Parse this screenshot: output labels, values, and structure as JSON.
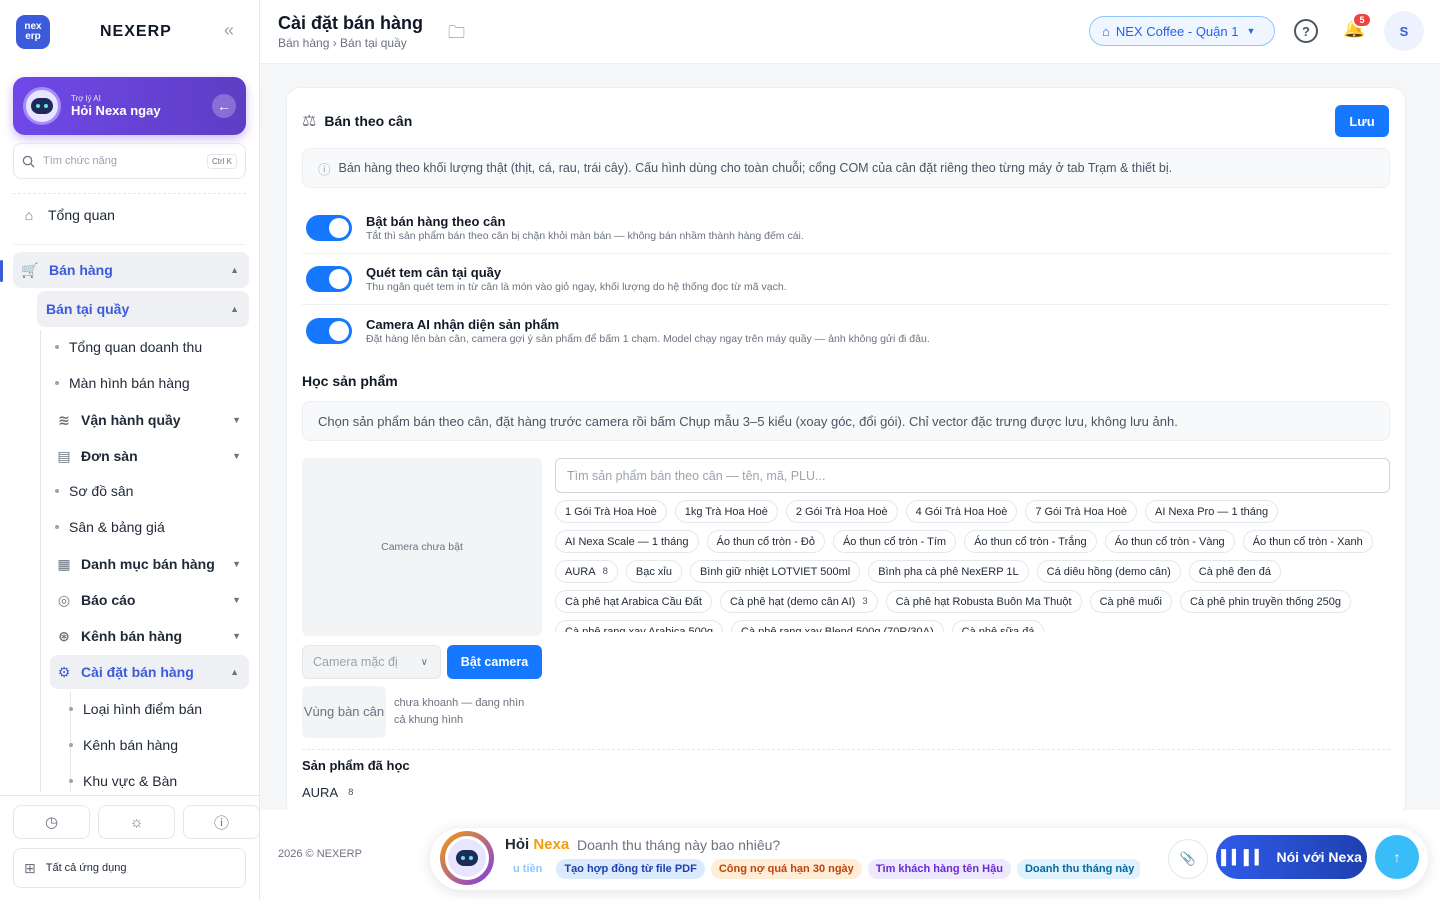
{
  "brand": {
    "logo_text": "nex erp",
    "name": "NEXERP",
    "collapse_icon": "double-chevron-left-icon"
  },
  "ai_card": {
    "small": "Trợ lý AI",
    "title": "Hỏi Nexa ngay"
  },
  "search": {
    "placeholder": "Tìm chức năng",
    "shortcut": "Ctrl K"
  },
  "nav": {
    "overview": "Tổng quan",
    "sales": "Bán hàng",
    "pos": "Bán tại quầy",
    "pos_items": [
      "Tổng quan doanh thu",
      "Màn hình bán hàng",
      "Vận hành quầy",
      "Đơn sàn",
      "Sơ đồ sân",
      "Sân & bảng giá",
      "Danh mục bán hàng",
      "Báo cáo",
      "Kênh bán hàng",
      "Cài đặt bán hàng"
    ],
    "settings_items": [
      "Loại hình điểm bán",
      "Kênh bán hàng",
      "Khu vực & Bàn"
    ]
  },
  "all_apps": "Tất cả ứng dụng",
  "header": {
    "title": "Cài đặt bán hàng",
    "breadcrumb": "Bán hàng › Bán tại quầy",
    "store": "NEX Coffee - Quận 1",
    "notif_count": "5",
    "avatar": "S"
  },
  "card": {
    "title": "Bán theo cân",
    "save": "Lưu",
    "info": "Bán hàng theo khối lượng thật (thịt, cá, rau, trái cây). Cấu hình dùng cho toàn chuỗi; cổng COM của cân đặt riêng theo từng máy ở tab Trạm & thiết bị.",
    "toggles": [
      {
        "title": "Bật bán hàng theo cân",
        "desc": "Tắt thì sản phẩm bán theo cân bị chặn khỏi màn bán — không bán nhầm thành hàng đếm cái.",
        "on": true
      },
      {
        "title": "Quét tem cân tại quầy",
        "desc": "Thu ngân quét tem in từ cân là món vào giỏ ngay, khối lượng do hệ thống đọc từ mã vạch.",
        "on": true
      },
      {
        "title": "Camera AI nhận diện sản phẩm",
        "desc": "Đặt hàng lên bàn cân, camera gợi ý sản phẩm để bấm 1 chạm. Model chạy ngay trên máy quầy — ảnh không gửi đi đâu.",
        "on": true
      }
    ],
    "learn_title": "Học sản phẩm",
    "learn_info": "Chọn sản phẩm bán theo cân, đặt hàng trước camera rồi bấm Chụp mẫu 3–5 kiểu (xoay góc, đổi gói). Chỉ vector đặc trưng được lưu, không lưu ảnh.",
    "camera_off": "Camera chưa bật",
    "camera_select": "Camera mặc đị",
    "camera_button": "Bật camera",
    "zone_label": "Vùng bàn cân",
    "zone_text": "chưa khoanh — đang nhìn cả khung hình",
    "product_search": "Tìm sản phẩm bán theo cân — tên, mã, PLU...",
    "products": [
      {
        "name": "1 Gói Trà Hoa Hoè"
      },
      {
        "name": "1kg Trà Hoa Hoè"
      },
      {
        "name": "2 Gói Trà Hoa Hoè"
      },
      {
        "name": "4 Gói Trà Hoa Hoè"
      },
      {
        "name": "7 Gói Trà Hoa Hoè"
      },
      {
        "name": "AI Nexa Pro — 1 tháng"
      },
      {
        "name": "AI Nexa Scale — 1 tháng"
      },
      {
        "name": "Áo thun cổ tròn - Đỏ"
      },
      {
        "name": "Áo thun cổ tròn - Tím"
      },
      {
        "name": "Áo thun cổ tròn - Trắng"
      },
      {
        "name": "Áo thun cổ tròn - Vàng"
      },
      {
        "name": "Áo thun cổ tròn - Xanh"
      },
      {
        "name": "AURA",
        "count": "8"
      },
      {
        "name": "Bạc xỉu"
      },
      {
        "name": "Bình giữ nhiệt LOTVIET 500ml"
      },
      {
        "name": "Bình pha cà phê NexERP 1L"
      },
      {
        "name": "Cá diêu hồng (demo cân)"
      },
      {
        "name": "Cà phê đen đá"
      },
      {
        "name": "Cà phê hạt Arabica Cầu Đất"
      },
      {
        "name": "Cà phê hạt (demo cân AI)",
        "count": "3"
      },
      {
        "name": "Cà phê hạt Robusta Buôn Ma Thuột"
      },
      {
        "name": "Cà phê muối"
      },
      {
        "name": "Cà phê phin truyền thống 250g"
      },
      {
        "name": "Cà phê rang xay Arabica 500g"
      },
      {
        "name": "Cà phê rang xay Blend 500g (70R/30A)"
      },
      {
        "name": "Cà phê sữa đá"
      }
    ],
    "learned_title": "Sản phẩm đã học",
    "learned": [
      {
        "name": "AURA",
        "count": "8"
      }
    ]
  },
  "footer": {
    "copyright": "2026 © NEXERP",
    "ask_prefix": "Hỏi ",
    "ask_brand": "Nexa",
    "ask_question": "Doanh thu tháng này bao nhiêu?",
    "suggestions": [
      "u tiền",
      "Tạo hợp đồng từ file PDF",
      "Công nợ quá hạn 30 ngày",
      "Tìm khách hàng tên Hậu",
      "Doanh thu tháng này"
    ],
    "voice": "Nói với Nexa"
  }
}
